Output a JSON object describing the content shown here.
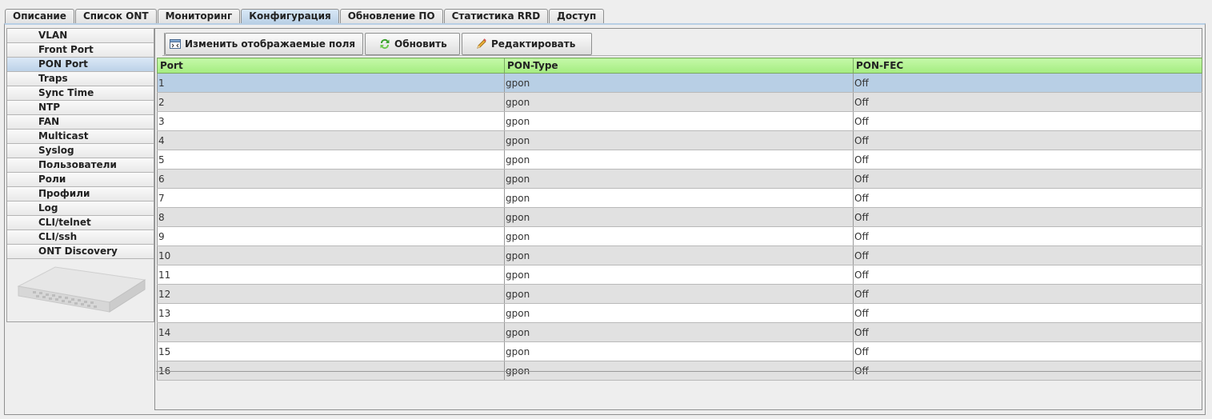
{
  "tabs": [
    {
      "label": "Описание",
      "active": false
    },
    {
      "label": "Список ONT",
      "active": false
    },
    {
      "label": "Мониторинг",
      "active": false
    },
    {
      "label": "Конфигурация",
      "active": true
    },
    {
      "label": "Обновление ПО",
      "active": false
    },
    {
      "label": "Статистика RRD",
      "active": false
    },
    {
      "label": "Доступ",
      "active": false
    }
  ],
  "sidebar": {
    "items": [
      {
        "label": "VLAN",
        "active": false
      },
      {
        "label": "Front Port",
        "active": false
      },
      {
        "label": "PON Port",
        "active": true
      },
      {
        "label": "Traps",
        "active": false
      },
      {
        "label": "Sync Time",
        "active": false
      },
      {
        "label": "NTP",
        "active": false
      },
      {
        "label": "FAN",
        "active": false
      },
      {
        "label": "Multicast",
        "active": false
      },
      {
        "label": "Syslog",
        "active": false
      },
      {
        "label": "Пользователи",
        "active": false
      },
      {
        "label": "Роли",
        "active": false
      },
      {
        "label": "Профили",
        "active": false
      },
      {
        "label": "Log",
        "active": false
      },
      {
        "label": "CLI/telnet",
        "active": false
      },
      {
        "label": "CLI/ssh",
        "active": false
      },
      {
        "label": "ONT Discovery",
        "active": false
      }
    ],
    "device_image_icon": "olt-device-image"
  },
  "toolbar": {
    "change_fields_label": "Изменить отображаемые поля",
    "change_fields_icon": "columns-icon",
    "refresh_label": "Обновить",
    "refresh_icon": "refresh-icon",
    "edit_label": "Редактировать",
    "edit_icon": "pencil-icon"
  },
  "table": {
    "columns": [
      "Port",
      "PON-Type",
      "PON-FEC"
    ],
    "selected_row": 0,
    "rows": [
      [
        "1",
        "gpon",
        "Off"
      ],
      [
        "2",
        "gpon",
        "Off"
      ],
      [
        "3",
        "gpon",
        "Off"
      ],
      [
        "4",
        "gpon",
        "Off"
      ],
      [
        "5",
        "gpon",
        "Off"
      ],
      [
        "6",
        "gpon",
        "Off"
      ],
      [
        "7",
        "gpon",
        "Off"
      ],
      [
        "8",
        "gpon",
        "Off"
      ],
      [
        "9",
        "gpon",
        "Off"
      ],
      [
        "10",
        "gpon",
        "Off"
      ],
      [
        "11",
        "gpon",
        "Off"
      ],
      [
        "12",
        "gpon",
        "Off"
      ],
      [
        "13",
        "gpon",
        "Off"
      ],
      [
        "14",
        "gpon",
        "Off"
      ],
      [
        "15",
        "gpon",
        "Off"
      ],
      [
        "16",
        "gpon",
        "Off"
      ]
    ]
  },
  "colors": {
    "header_green": "#a4ec80",
    "selection_blue": "#b8cfe5",
    "row_alt_gray": "#e1e1e1"
  }
}
